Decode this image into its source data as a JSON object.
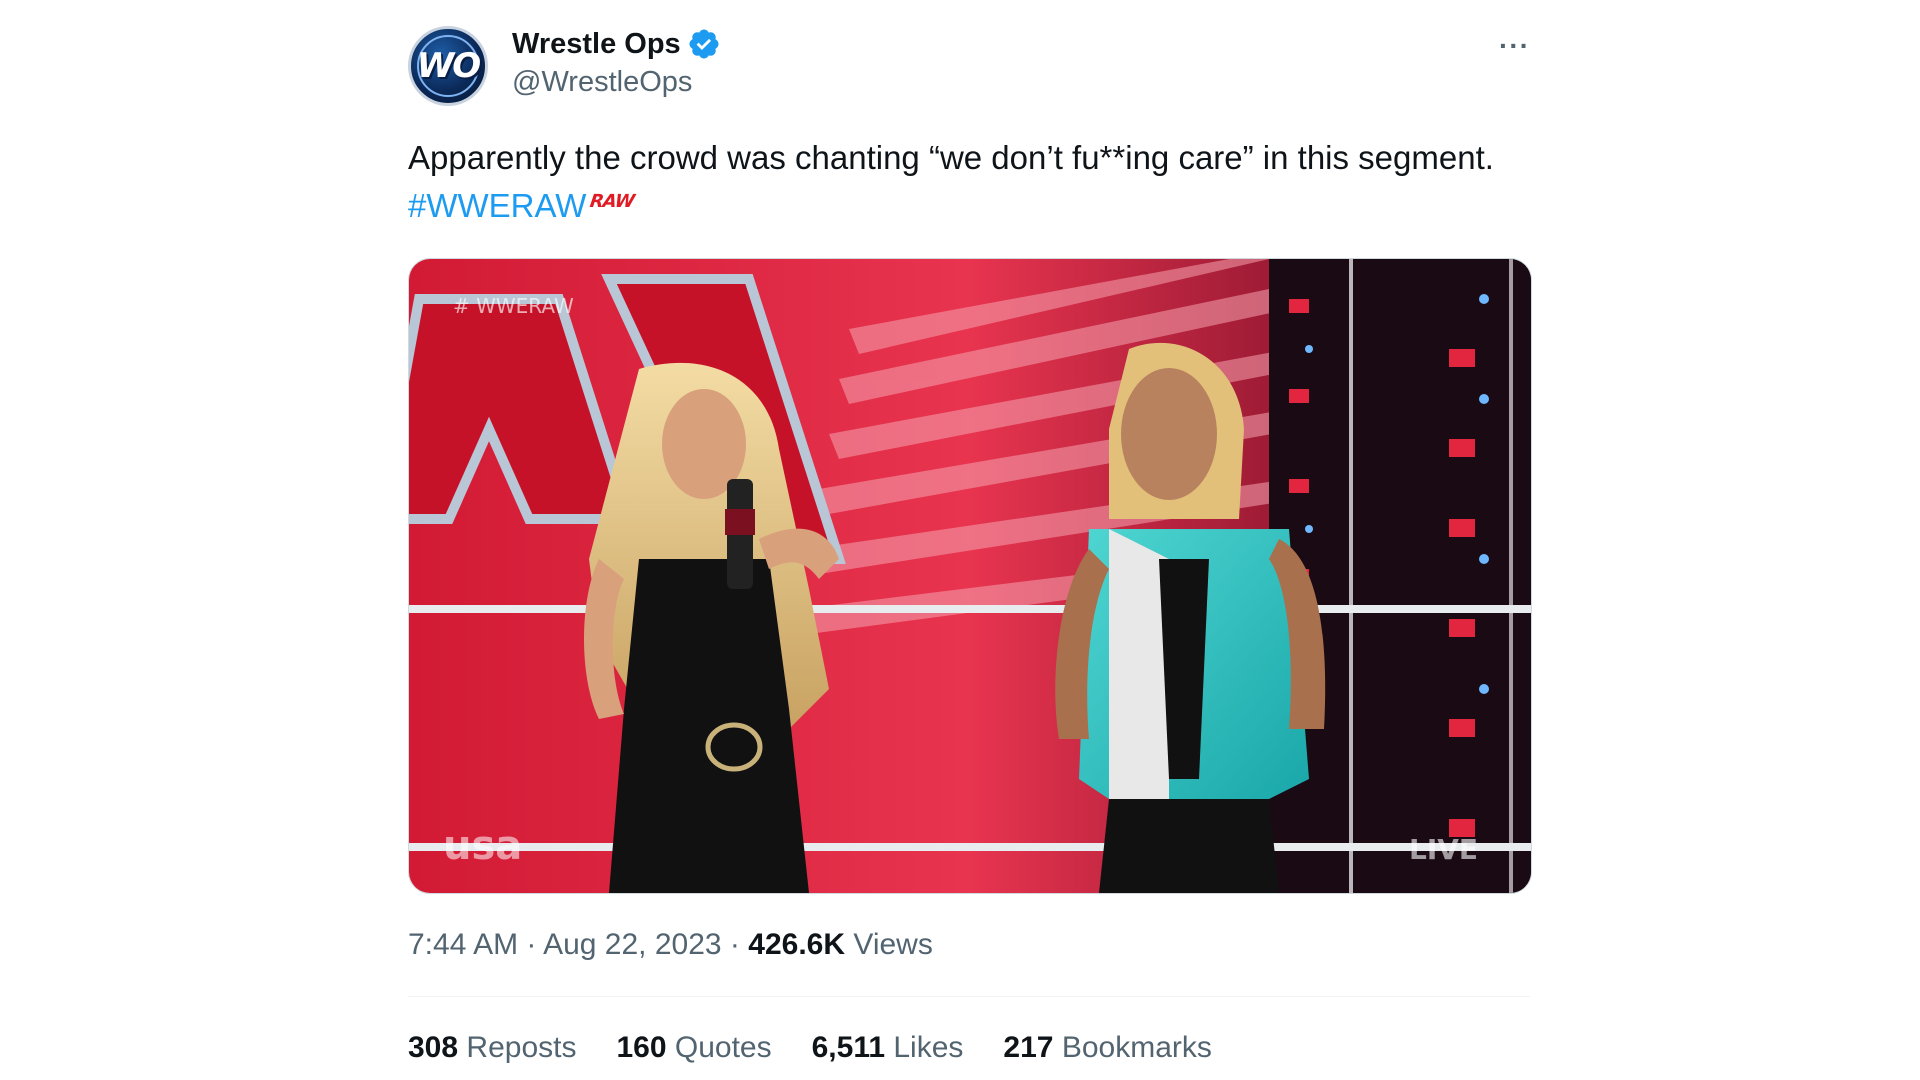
{
  "author": {
    "display_name": "Wrestle Ops",
    "handle": "@WrestleOps",
    "avatar_text": "WO",
    "verified": true,
    "verified_color": "#1d9bf0"
  },
  "more_label": "···",
  "tweet": {
    "text": "Apparently the crowd was chanting “we don’t fu**ing care” in this segment.",
    "hashtag": "#WWERAW",
    "hashtag_emoji_text": "RAW",
    "hashtag_color": "#1d9bf0"
  },
  "media": {
    "watermark_hashtag": "# WWERAW",
    "network_logo": "usa",
    "live_bug": "LIVE"
  },
  "meta": {
    "time": "7:44 AM",
    "sep1": " · ",
    "date": "Aug 22, 2023",
    "sep2": " · ",
    "views_count": "426.6K",
    "views_label": "Views"
  },
  "stats": [
    {
      "count": "308",
      "label": "Reposts"
    },
    {
      "count": "160",
      "label": "Quotes"
    },
    {
      "count": "6,511",
      "label": "Likes"
    },
    {
      "count": "217",
      "label": "Bookmarks"
    }
  ]
}
